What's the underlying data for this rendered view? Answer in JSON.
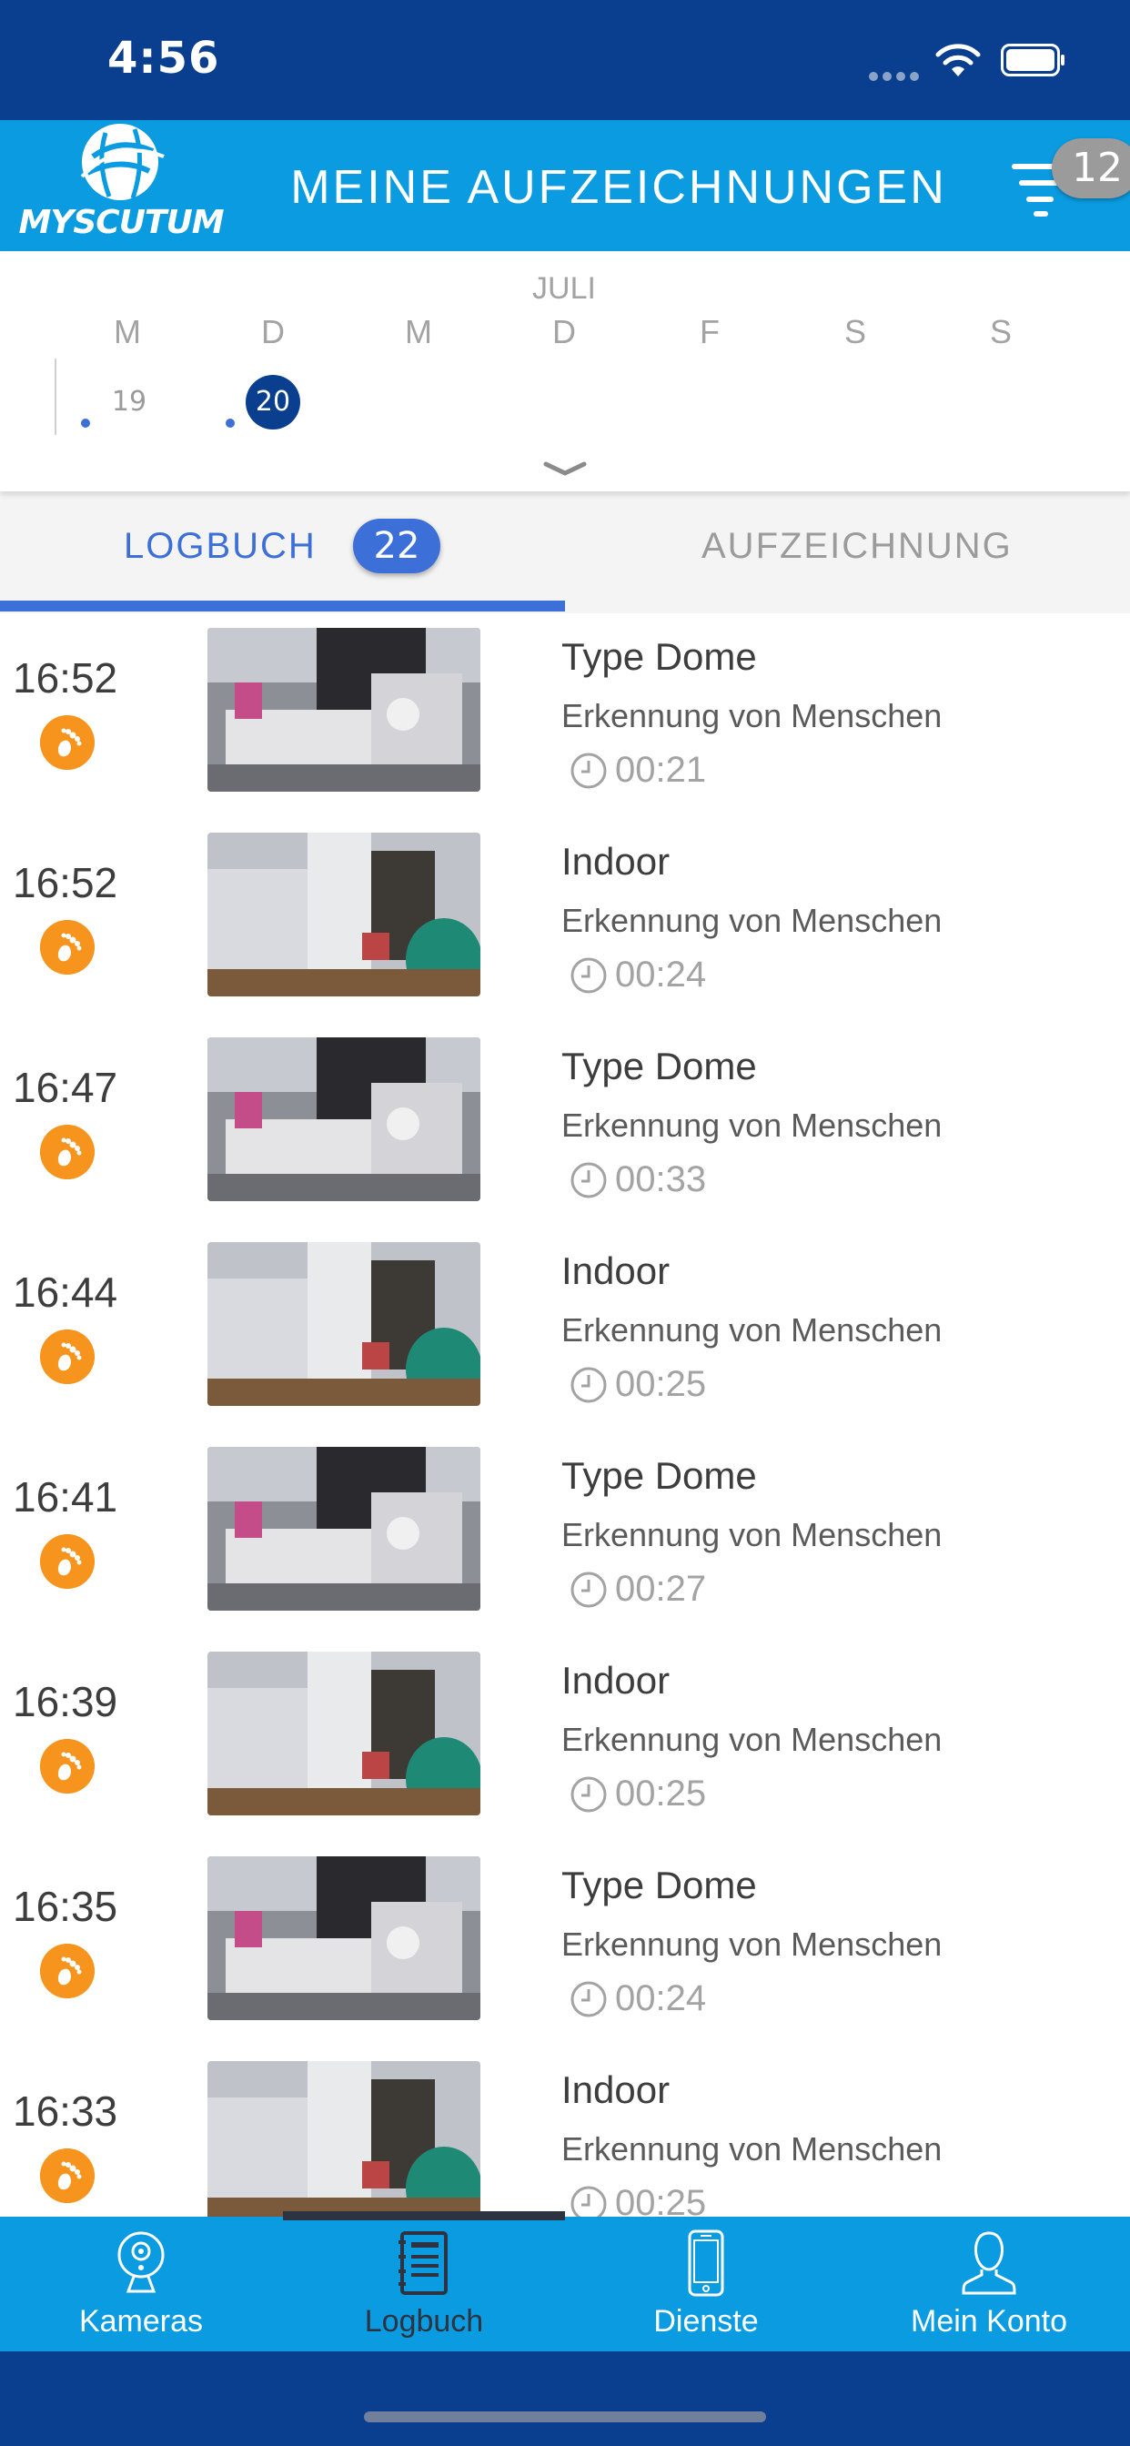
{
  "status_bar": {
    "time": "4:56"
  },
  "header": {
    "logo_text": "MYSCUTUM",
    "title": "MEINE AUFZEICHNUNGEN",
    "filter_badge": "12"
  },
  "calendar": {
    "month": "JULI",
    "weekdays": [
      "M",
      "D",
      "M",
      "D",
      "F",
      "S",
      "S"
    ],
    "days": [
      {
        "num": "19",
        "has_event": true,
        "selected": false
      },
      {
        "num": "20",
        "has_event": true,
        "selected": true
      }
    ]
  },
  "tabs": [
    {
      "label": "LOGBUCH",
      "badge": "22",
      "active": true
    },
    {
      "label": "AUFZEICHNUNG",
      "active": false
    }
  ],
  "colors": {
    "status_bar": "#0a3f8f",
    "header": "#0b9be0",
    "accent": "#3d6fd8",
    "motion_badge": "#f7941d"
  },
  "recordings": [
    {
      "time": "16:52",
      "camera": "Type Dome",
      "event": "Erkennung von Menschen",
      "duration": "00:21",
      "icon": "footprint-icon"
    },
    {
      "time": "16:52",
      "camera": "Indoor",
      "event": "Erkennung von Menschen",
      "duration": "00:24",
      "icon": "footprint-icon"
    },
    {
      "time": "16:47",
      "camera": "Type Dome",
      "event": "Erkennung von Menschen",
      "duration": "00:33",
      "icon": "footprint-icon"
    },
    {
      "time": "16:44",
      "camera": "Indoor",
      "event": "Erkennung von Menschen",
      "duration": "00:25",
      "icon": "footprint-icon"
    },
    {
      "time": "16:41",
      "camera": "Type Dome",
      "event": "Erkennung von Menschen",
      "duration": "00:27",
      "icon": "footprint-icon"
    },
    {
      "time": "16:39",
      "camera": "Indoor",
      "event": "Erkennung von Menschen",
      "duration": "00:25",
      "icon": "footprint-icon"
    },
    {
      "time": "16:35",
      "camera": "Type Dome",
      "event": "Erkennung von Menschen",
      "duration": "00:24",
      "icon": "footprint-icon"
    },
    {
      "time": "16:33",
      "camera": "Indoor",
      "event": "Erkennung von Menschen",
      "duration": "00:25",
      "icon": "footprint-icon"
    }
  ],
  "bottom_nav": [
    {
      "label": "Kameras",
      "icon": "camera-icon",
      "active": false
    },
    {
      "label": "Logbuch",
      "icon": "logbook-icon",
      "active": true
    },
    {
      "label": "Dienste",
      "icon": "phone-icon",
      "active": false
    },
    {
      "label": "Mein Konto",
      "icon": "account-icon",
      "active": false
    }
  ]
}
